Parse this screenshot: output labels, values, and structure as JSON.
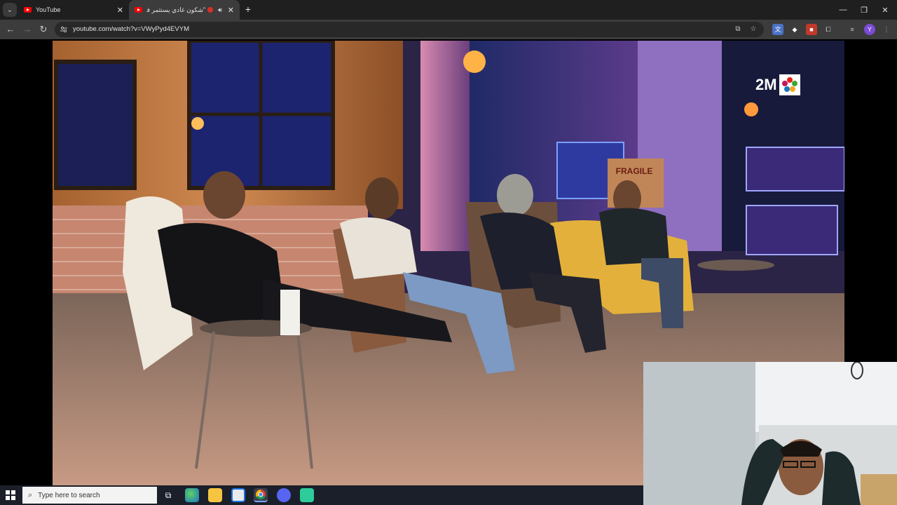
{
  "browser": {
    "tabs": [
      {
        "title": "YouTube",
        "active": false
      },
      {
        "title": "\"شكون غادي يستثمر فمة...",
        "active": true,
        "recording": true,
        "audio": true
      }
    ],
    "url": "youtube.com/watch?v=VWyPyd4EVYM",
    "window_controls": [
      "minimize",
      "restore",
      "close"
    ]
  },
  "video": {
    "channel_logo_text": "2M",
    "prop_text": "FRAGILE"
  },
  "taskbar": {
    "search_placeholder": "Type here to search",
    "pinned": [
      "task-view",
      "edge",
      "file-explorer",
      "store",
      "chrome",
      "discord",
      "terminal"
    ]
  },
  "colors": {
    "tabstrip_bg": "#1f1f1f",
    "toolbar_bg": "#3c3c3c",
    "youtube_red": "#ff0000",
    "taskbar_bg": "#1b1f2a"
  }
}
